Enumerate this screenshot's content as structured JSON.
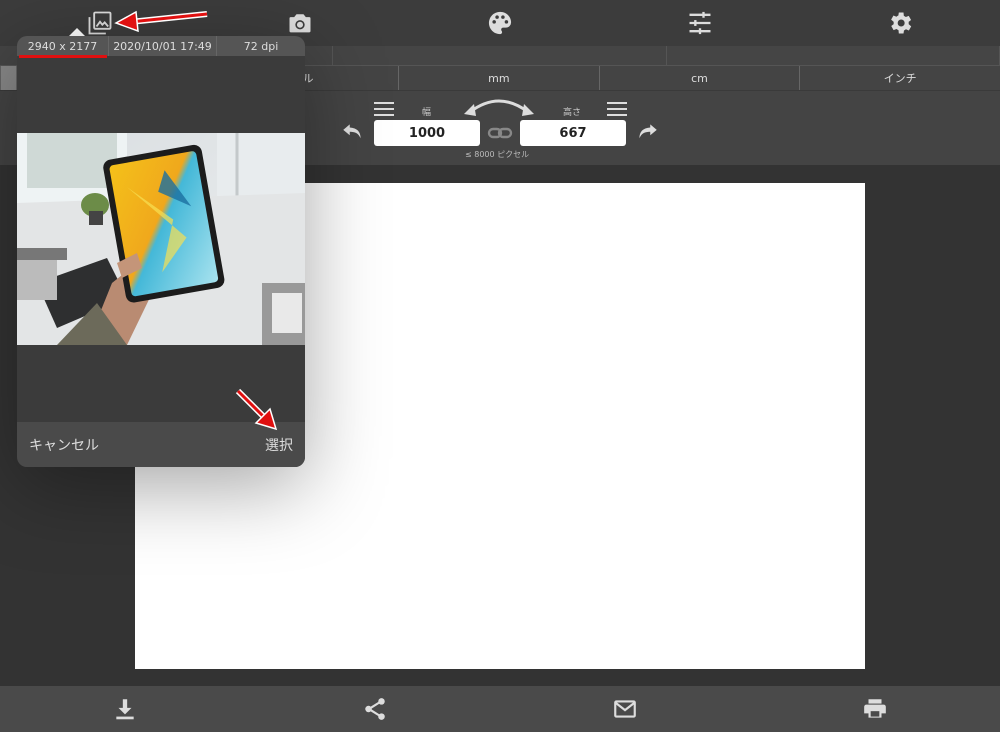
{
  "toolbar": {
    "icons": [
      "gallery-icon",
      "camera-icon",
      "palette-icon",
      "sliders-icon",
      "gear-icon"
    ]
  },
  "units": {
    "items": [
      "セル",
      "mm",
      "cm",
      "インチ"
    ]
  },
  "size": {
    "width_label": "幅",
    "height_label": "高さ",
    "width_value": "1000",
    "height_value": "667",
    "limit_note": "≤ 8000 ピクセル"
  },
  "popover": {
    "dimensions": "2940 x 2177",
    "datetime": "2020/10/01 17:49",
    "dpi": "72 dpi",
    "cancel_label": "キャンセル",
    "select_label": "選択"
  },
  "bottombar": {
    "icons": [
      "download-icon",
      "share-icon",
      "mail-icon",
      "print-icon"
    ]
  },
  "colors": {
    "annotation_red": "#e01010",
    "bar_bg": "#3c3c3c",
    "canvas": "#ffffff"
  }
}
